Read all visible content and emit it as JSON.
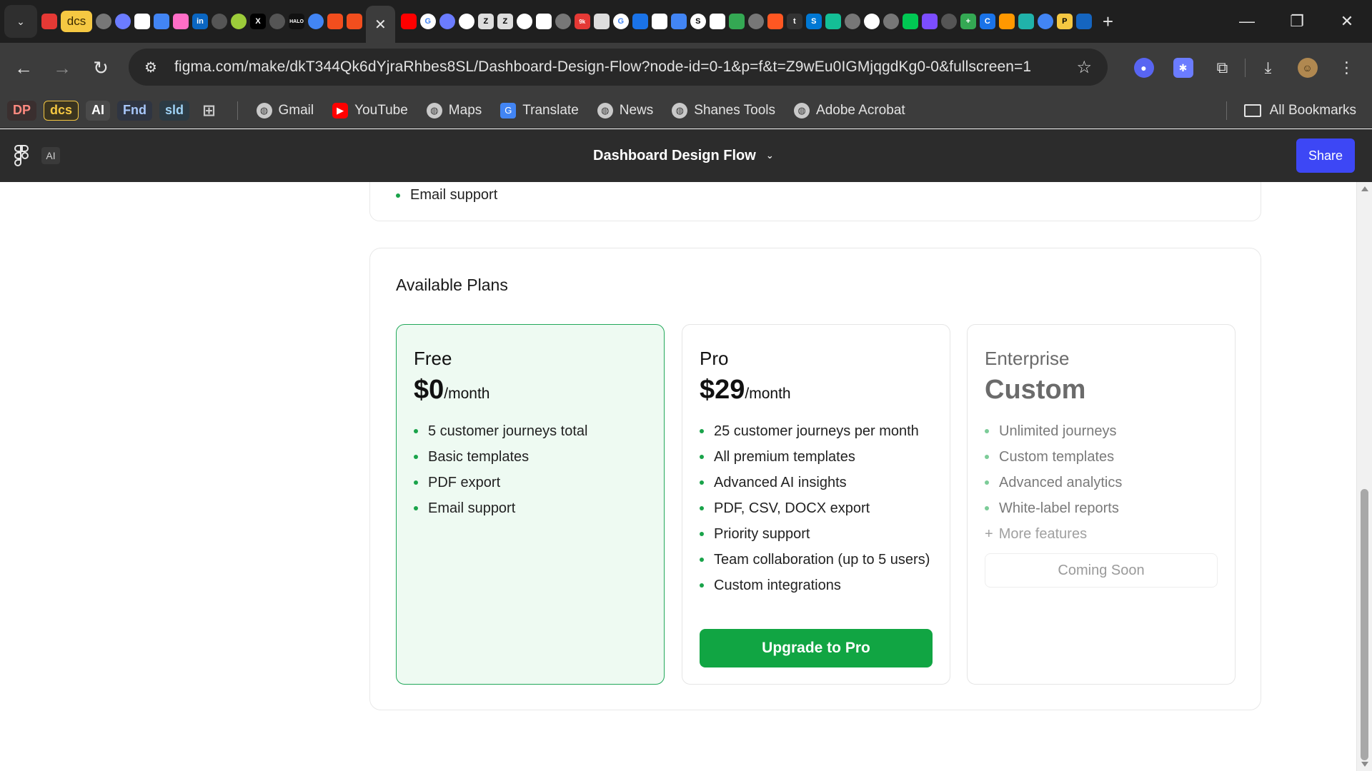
{
  "browser": {
    "tab_strip": {
      "pinned_chip_label": "dcs",
      "active_tab_close": "✕",
      "new_tab_label": "+",
      "favicon_icons": [
        "pin-icon",
        "globe-icon",
        "puzzle-icon",
        "doc-icon",
        "star-icon",
        "asterisk-icon",
        "linkedin-icon",
        "copilot-icon",
        "smiley-icon",
        "x-icon",
        "openai-icon",
        "halo-icon",
        "chrome-icon",
        "figma-icon",
        "youtube-icon",
        "google-icon",
        "github-icon",
        "zotero-icon",
        "zotero-icon",
        "github-icon",
        "sheets-icon",
        "google-icon",
        "download-icon",
        "chart-icon",
        "docs-icon",
        "s-icon",
        "chess-icon",
        "maps-icon",
        "globe-icon",
        "tiktok-icon",
        "twitter-icon",
        "skype-icon",
        "khan-icon",
        "github-icon",
        "globe-icon",
        "drive-icon",
        "notion-icon",
        "openai-icon",
        "plus-icon",
        "copilot-icon",
        "claude-icon",
        "perplexity-icon",
        "gemini-icon",
        "p-icon",
        "list-icon"
      ]
    },
    "window_controls": {
      "minimize": "—",
      "restore": "❐",
      "close": "✕"
    },
    "toolbar": {
      "url": "figma.com/make/dkT344Qk6dYjraRhbes8SL/Dashboard-Design-Flow?node-id=0-1&p=f&t=Z9wEu0IGMjqgdKg0-0&fullscreen=1"
    },
    "bookmarks": {
      "chips": [
        {
          "label": "DP",
          "bg": "#3a2f2f",
          "fg": "#ff8a80"
        },
        {
          "label": "dcs",
          "bg": "#3a3420",
          "fg": "#f5c842"
        },
        {
          "label": "AI",
          "bg": "#4a4a4a",
          "fg": "#ffffff"
        },
        {
          "label": "Fnd",
          "bg": "#2f3542",
          "fg": "#a8c7fa"
        },
        {
          "label": "sld",
          "bg": "#2c3b44",
          "fg": "#9fd3f5"
        }
      ],
      "items": [
        {
          "label": "Gmail",
          "icon": "globe-icon"
        },
        {
          "label": "YouTube",
          "icon": "youtube-icon"
        },
        {
          "label": "Maps",
          "icon": "globe-icon"
        },
        {
          "label": "Translate",
          "icon": "translate-icon"
        },
        {
          "label": "News",
          "icon": "globe-icon"
        },
        {
          "label": "Shanes Tools",
          "icon": "globe-icon"
        },
        {
          "label": "Adobe Acrobat",
          "icon": "globe-icon"
        }
      ],
      "all_bookmarks": "All Bookmarks"
    }
  },
  "figma": {
    "ai_badge": "AI",
    "file_title": "Dashboard Design Flow",
    "share_label": "Share",
    "accent": "#3d47f5"
  },
  "app": {
    "previous_card_last_feature": "Email support",
    "plans_title": "Available Plans",
    "plans": [
      {
        "name": "Free",
        "price": "$0",
        "period": "/month",
        "features": [
          "5 customer journeys total",
          "Basic templates",
          "PDF export",
          "Email support"
        ]
      },
      {
        "name": "Pro",
        "price": "$29",
        "period": "/month",
        "features": [
          "25 customer journeys per month",
          "All premium templates",
          "Advanced AI insights",
          "PDF, CSV, DOCX export",
          "Priority support",
          "Team collaboration (up to 5 users)",
          "Custom integrations"
        ],
        "cta": "Upgrade to Pro"
      },
      {
        "name": "Enterprise",
        "price": "Custom",
        "features": [
          "Unlimited journeys",
          "Custom templates",
          "Advanced analytics",
          "White-label reports"
        ],
        "more": "More features",
        "cta": "Coming Soon"
      }
    ],
    "colors": {
      "brand_green": "#11a543",
      "free_bg": "#eefaf2",
      "free_border": "#22a85a"
    }
  }
}
